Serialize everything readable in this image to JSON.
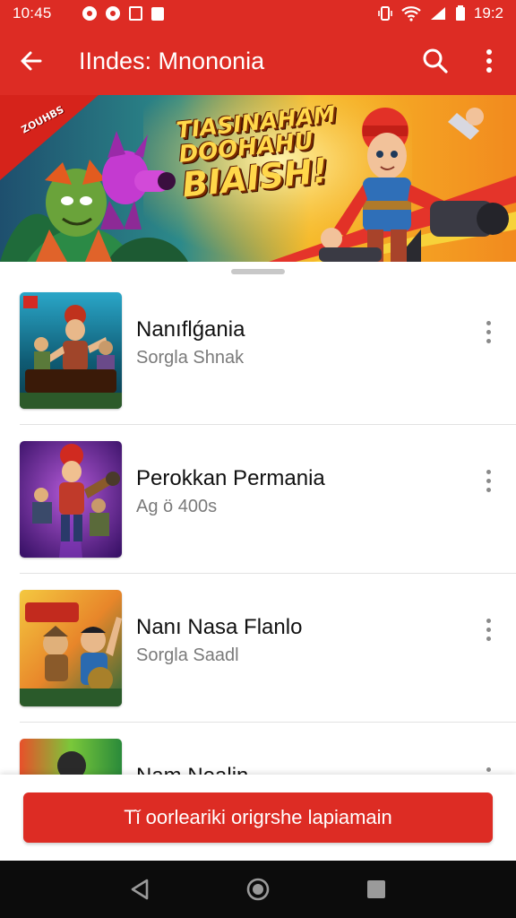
{
  "status_bar": {
    "time": "10:45",
    "battery": "19:2"
  },
  "app_bar": {
    "title": "IIndes: Mnononia",
    "back_icon": "arrow-left-icon",
    "search_icon": "search-icon",
    "more_icon": "more-vertical-icon"
  },
  "banner": {
    "headline": [
      "TIASINAHAM",
      "DOOHAHU",
      "BIAISH!"
    ],
    "ribbon": "ZOUHBS",
    "colors": {
      "sky": "#f3a51f",
      "accent": "#e4342a"
    }
  },
  "games": [
    {
      "title": "Nanıflǵania",
      "subtitle": "Sorgla Shnak",
      "thumb_caption": "MEALIAWIN"
    },
    {
      "title": "Perokkan Permania",
      "subtitle": "Ag ö 400s",
      "thumb_caption": ""
    },
    {
      "title": "Nanı Nasa Flanlo",
      "subtitle": "Sorgla Saadl",
      "thumb_caption": "SUMMIT"
    },
    {
      "title": "Nam Nealin",
      "subtitle": "",
      "thumb_caption": ""
    }
  ],
  "footer": {
    "cta_label": "Tǐ oorleariki origrshe lapiamain"
  },
  "nav": {
    "back_icon": "nav-back-icon",
    "home_icon": "nav-home-icon",
    "recents_icon": "nav-recents-icon"
  },
  "theme": {
    "primary": "#dd2c24",
    "nav": "#0c0c0c"
  }
}
